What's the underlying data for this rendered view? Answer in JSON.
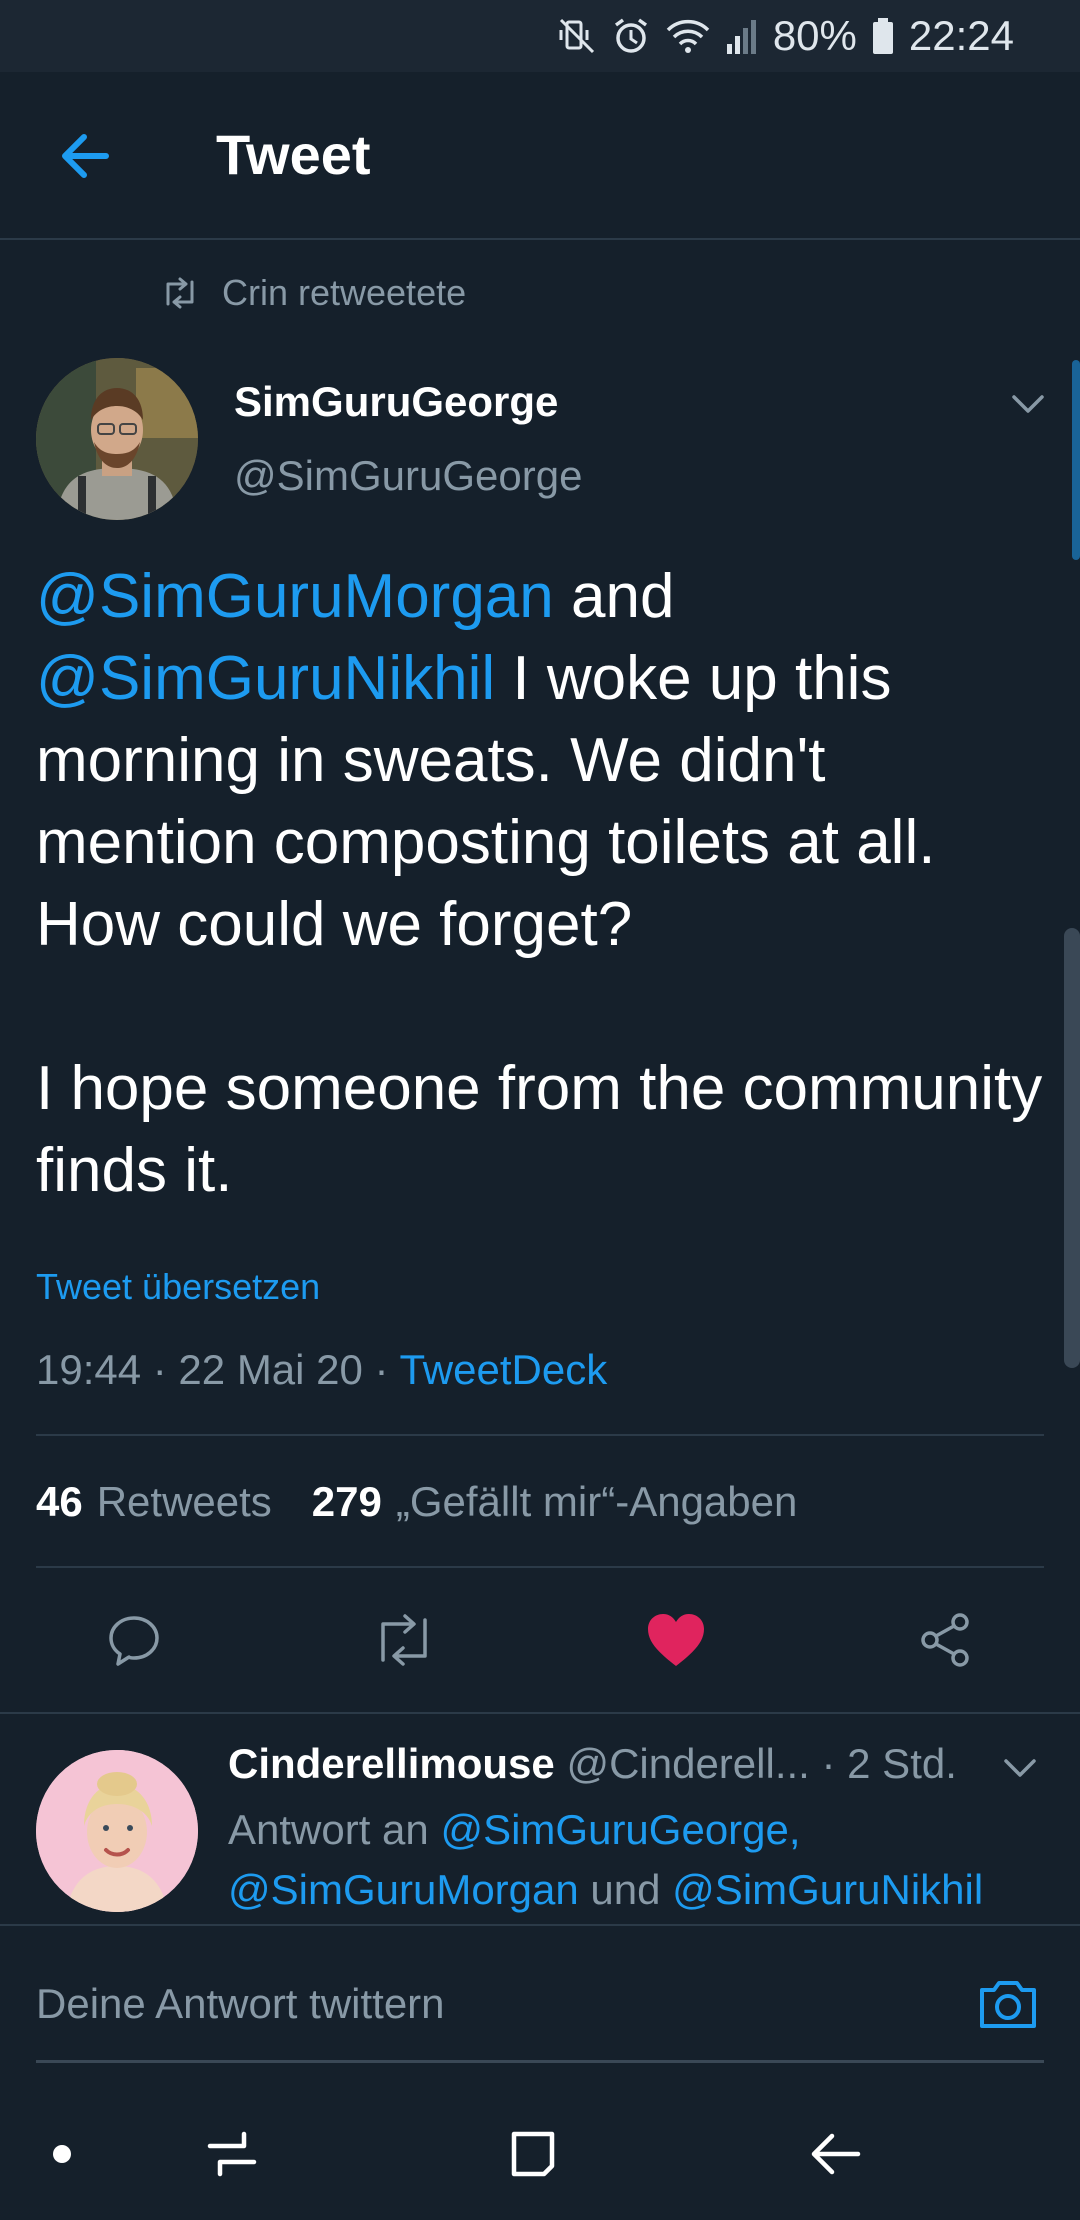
{
  "status_bar": {
    "battery": "80%",
    "time": "22:24",
    "icons": [
      "mute-vibrate-icon",
      "alarm-icon",
      "wifi-icon",
      "signal-icon",
      "battery-icon"
    ]
  },
  "header": {
    "title": "Tweet",
    "back_icon": "arrow-left-icon"
  },
  "retweet_context": {
    "icon": "retweet-icon",
    "text": "Crin retweetete"
  },
  "tweet": {
    "author_name": "SimGuruGeorge",
    "author_handle": "@SimGuruGeorge",
    "body": {
      "mention_1": "@SimGuruMorgan",
      "text_1": " and ",
      "mention_2": "@SimGuruNikhil",
      "text_2": "  I woke up this morning in sweats.  We didn't mention composting toilets at all. How could we forget?",
      "paragraph_2": "I hope someone from the community finds it."
    },
    "translate_label": "Tweet übersetzen",
    "timestamp": "19:44 · 22 Mai 20 · ",
    "source": "TweetDeck",
    "retweets_count": "46",
    "retweets_label": "Retweets",
    "likes_count": "279",
    "likes_label": "„Gefällt mir“-Angaben",
    "liked": true,
    "colors": {
      "accent": "#1d9bf0",
      "like": "#e0245e",
      "background": "#15202b",
      "muted": "#8899a6"
    }
  },
  "reply": {
    "author_name": "Cinderellimouse",
    "author_handle": "@Cinderell...",
    "time": " · 2 Std.",
    "reply_prefix": "Antwort an ",
    "mention_1": "@SimGuruGeorge,",
    "mention_2": "@SimGuruMorgan",
    "join": " und ",
    "mention_3": "@SimGuruNikhil"
  },
  "composer": {
    "placeholder": "Deine Antwort twittern",
    "camera_icon": "camera-icon"
  },
  "nav_bar": {
    "icons": [
      "dot-icon",
      "recent-apps-icon",
      "home-icon",
      "back-icon"
    ]
  }
}
